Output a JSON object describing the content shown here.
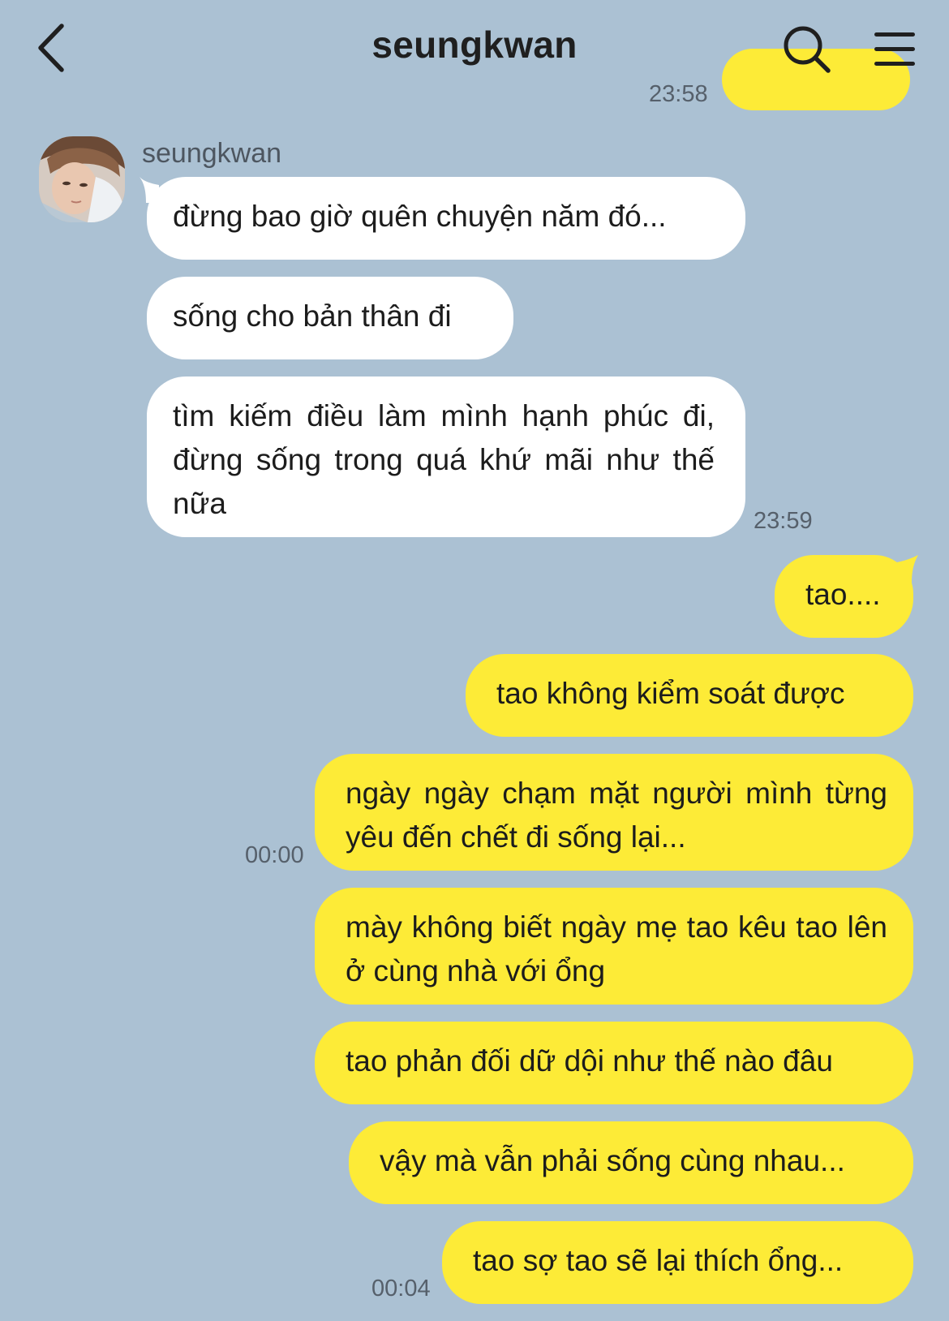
{
  "header": {
    "title": "seungkwan",
    "back_icon": "chevron-left-icon",
    "search_icon": "search-icon",
    "menu_icon": "hamburger-menu-icon"
  },
  "colors": {
    "background": "#abc1d3",
    "incoming_bubble": "#ffffff",
    "outgoing_bubble": "#fdeb37",
    "time_text": "#56606b"
  },
  "top_partial": {
    "time": "23:58"
  },
  "incoming": {
    "sender": "seungkwan",
    "messages": [
      "đừng bao giờ quên chuyện năm đó...",
      "sống cho bản thân đi",
      "tìm kiếm điều làm mình hạnh phúc đi, đừng sống trong quá khứ mãi như thế nữa"
    ],
    "time": "23:59"
  },
  "outgoing": {
    "messages": [
      "tao....",
      "tao không kiểm soát được",
      "ngày ngày chạm mặt người mình từng yêu đến chết đi sống lại...",
      "mày không biết ngày mẹ tao kêu tao lên ở cùng nhà với ổng",
      "tao phản đối dữ dội như thế nào đâu",
      "vậy mà vẫn phải sống cùng nhau...",
      "tao sợ tao sẽ lại thích ổng..."
    ],
    "time_group1": "00:00",
    "time_group2": "00:04"
  }
}
